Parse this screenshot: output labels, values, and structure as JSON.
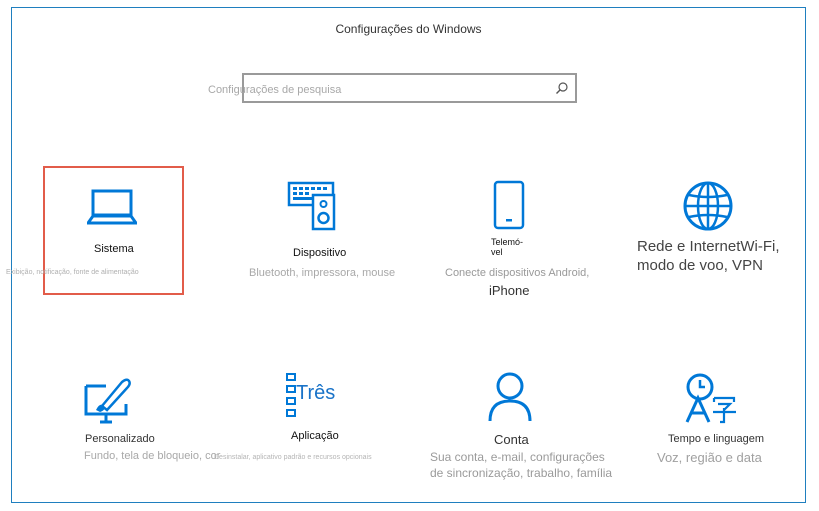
{
  "window": {
    "title": "Configurações do Windows"
  },
  "search": {
    "placeholder": "Configurações de pesquisa"
  },
  "tiles": [
    {
      "name": "Sistema",
      "desc": "Exibição, notificação, fonte de alimentação",
      "icon": "laptop-icon"
    },
    {
      "name": "Dispositivo",
      "desc": "Bluetooth, impressora, mouse",
      "icon": "keyboard-speaker-icon"
    },
    {
      "name_line1": "Telemó-",
      "name_line2": "vel",
      "desc": "Conecte dispositivos Android,",
      "desc2": "iPhone",
      "icon": "phone-icon"
    },
    {
      "name_line1": "Rede e InternetWi-Fi,",
      "name_line2": "modo de voo, VPN",
      "icon": "globe-icon"
    },
    {
      "name": "Personalizado",
      "desc": "Fundo, tela de bloqueio, cor",
      "icon": "paintbrush-icon"
    },
    {
      "name": "Aplicação",
      "desc": "Desinstalar, aplicativo padrão e recursos opcionais",
      "icon_text": "Três",
      "icon": "apps-list-icon"
    },
    {
      "name": "Conta",
      "desc": "Sua conta, e-mail, configurações",
      "desc2": "de sincronização, trabalho, família",
      "icon": "person-icon"
    },
    {
      "name": "Tempo e linguagem",
      "desc": "Voz, região e data",
      "icon": "time-language-icon"
    }
  ],
  "colors": {
    "accent": "#0078d7",
    "selected_border": "#e25c4a",
    "window_border": "#1f7fbf"
  }
}
